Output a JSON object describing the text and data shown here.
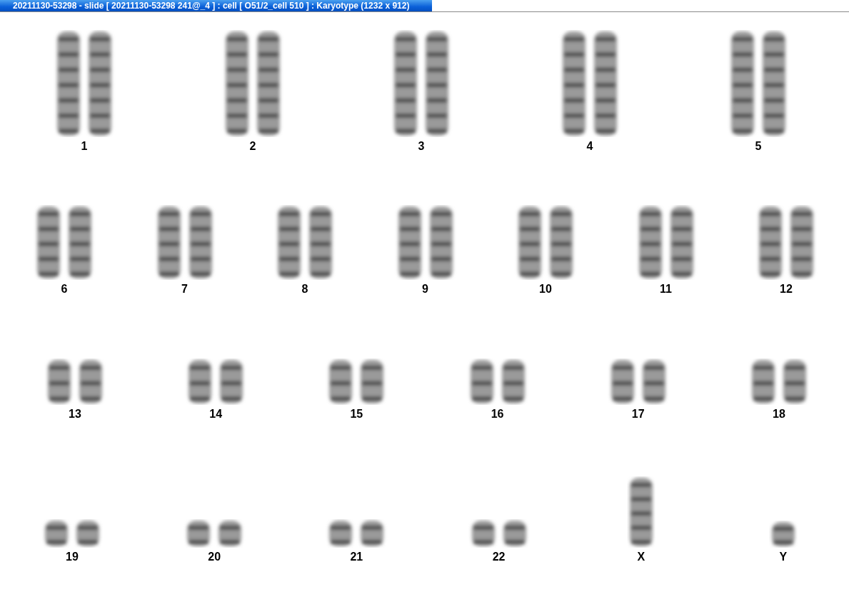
{
  "window": {
    "title": "20211130-53298 - slide [ 20211130-53298 241@_4 ] : cell [ O51/2_cell 510 ] : Karyotype  (1232 x 912)"
  },
  "karyotype": {
    "rows": [
      [
        {
          "label": "1",
          "kind": "pair"
        },
        {
          "label": "2",
          "kind": "pair"
        },
        {
          "label": "3",
          "kind": "pair"
        },
        {
          "label": "4",
          "kind": "pair"
        },
        {
          "label": "5",
          "kind": "pair"
        }
      ],
      [
        {
          "label": "6",
          "kind": "pair"
        },
        {
          "label": "7",
          "kind": "pair"
        },
        {
          "label": "8",
          "kind": "pair"
        },
        {
          "label": "9",
          "kind": "pair"
        },
        {
          "label": "10",
          "kind": "pair"
        },
        {
          "label": "11",
          "kind": "pair"
        },
        {
          "label": "12",
          "kind": "pair"
        }
      ],
      [
        {
          "label": "13",
          "kind": "pair"
        },
        {
          "label": "14",
          "kind": "pair"
        },
        {
          "label": "15",
          "kind": "pair"
        },
        {
          "label": "16",
          "kind": "pair"
        },
        {
          "label": "17",
          "kind": "pair"
        },
        {
          "label": "18",
          "kind": "pair"
        }
      ],
      [
        {
          "label": "19",
          "kind": "pair"
        },
        {
          "label": "20",
          "kind": "pair"
        },
        {
          "label": "21",
          "kind": "pair"
        },
        {
          "label": "22",
          "kind": "pair"
        },
        {
          "label": "X",
          "kind": "single"
        },
        {
          "label": "Y",
          "kind": "single"
        }
      ]
    ]
  }
}
